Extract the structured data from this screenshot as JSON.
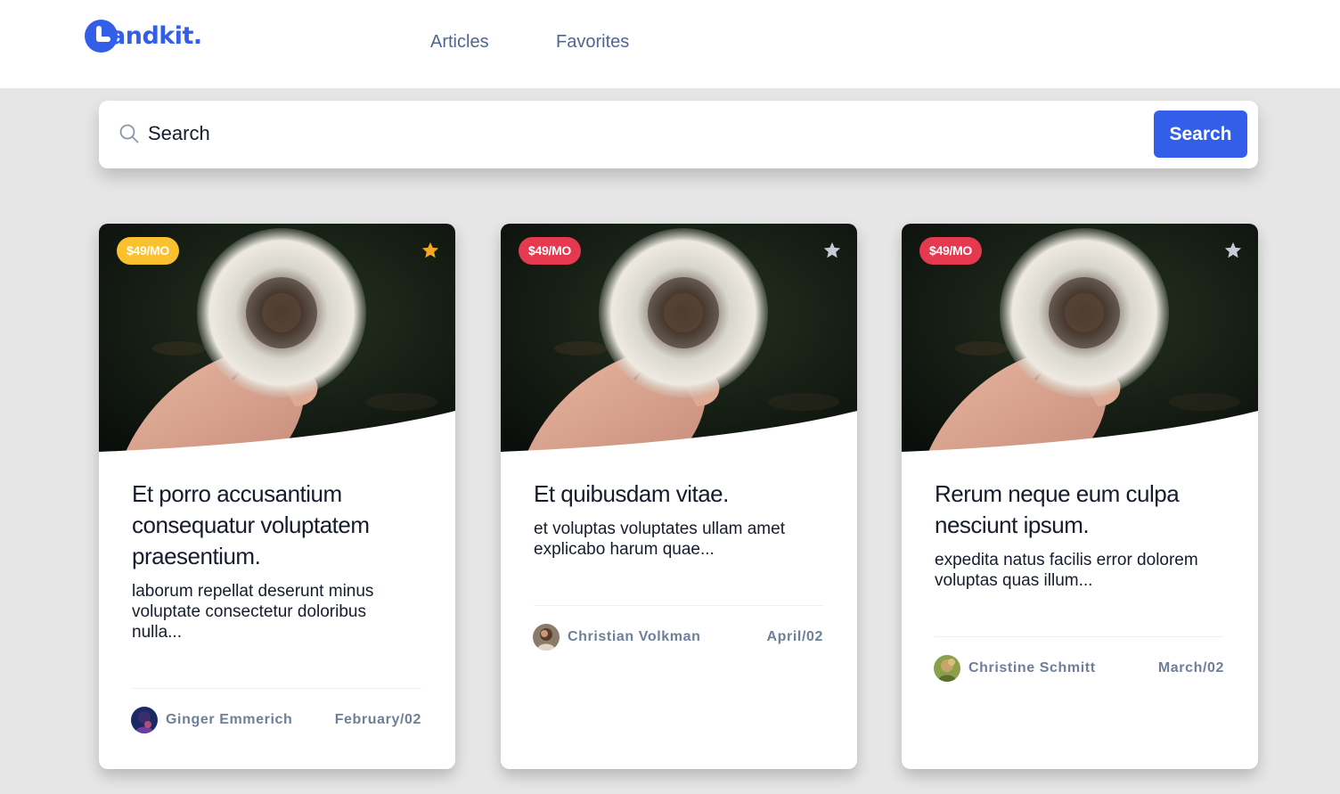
{
  "header": {
    "logo_text": "andkit.",
    "nav": [
      {
        "label": "Articles"
      },
      {
        "label": "Favorites"
      }
    ]
  },
  "search": {
    "placeholder": "Search",
    "button_label": "Search"
  },
  "colors": {
    "accent": "#335eea",
    "badge_yellow": "#fbc02d",
    "badge_red": "#e53950",
    "star_active": "#f5a623",
    "star_inactive": "#c7cbd8"
  },
  "cards": [
    {
      "price": "$49/MO",
      "price_badge_color": "#fbc02d",
      "favorited": true,
      "title": "Et porro accusantium consequatur voluptatem praesentium.",
      "description": "laborum repellat deserunt minus voluptate consectetur doloribus nulla...",
      "author": "Ginger Emmerich",
      "date": "February/02"
    },
    {
      "price": "$49/MO",
      "price_badge_color": "#e53950",
      "favorited": false,
      "title": "Et quibusdam vitae.",
      "description": "et voluptas voluptates ullam amet explicabo harum quae...",
      "author": "Christian Volkman",
      "date": "April/02"
    },
    {
      "price": "$49/MO",
      "price_badge_color": "#e53950",
      "favorited": false,
      "title": "Rerum neque eum culpa nesciunt ipsum.",
      "description": "expedita natus facilis error dolorem voluptas quas illum...",
      "author": "Christine Schmitt",
      "date": "March/02"
    }
  ]
}
